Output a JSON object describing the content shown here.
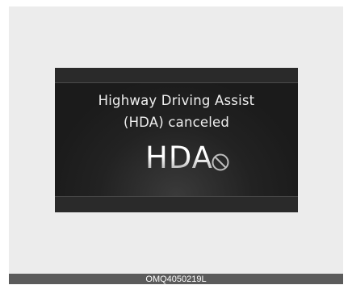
{
  "display": {
    "message_line1": "Highway Driving Assist",
    "message_line2": "(HDA) canceled",
    "indicator_label": "HDA",
    "indicator_icon": "no-symbol-icon"
  },
  "caption": {
    "code": "OMQ4050219L"
  },
  "colors": {
    "outer_background": "#ececec",
    "display_background": "#1b1b1b",
    "text": "#efefef",
    "caption_bar": "#5b5b5b"
  }
}
